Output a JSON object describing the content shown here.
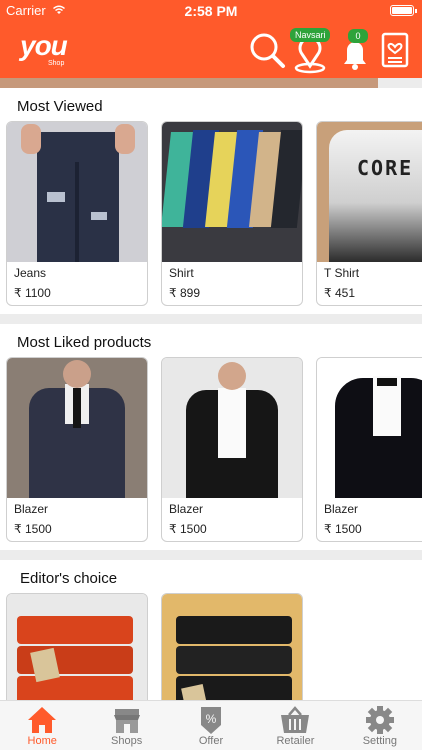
{
  "status_bar": {
    "carrier": "Carrier",
    "time": "2:58 PM"
  },
  "header": {
    "logo_text": "you",
    "logo_sub": "Shop",
    "location_badge": "Navsari",
    "notification_count": "0"
  },
  "sections": [
    {
      "title": "Most Viewed",
      "items": [
        {
          "name": "Jeans",
          "price": "₹ 1100"
        },
        {
          "name": "Shirt",
          "price": "₹ 899"
        },
        {
          "name": "T Shirt",
          "price": "₹ 451"
        }
      ]
    },
    {
      "title": "Most Liked products",
      "items": [
        {
          "name": "Blazer",
          "price": "₹ 1500"
        },
        {
          "name": "Blazer",
          "price": "₹ 1500"
        },
        {
          "name": "Blazer",
          "price": "₹ 1500"
        }
      ]
    },
    {
      "title": "Editor's choice",
      "items": [
        {
          "name": "",
          "price": ""
        },
        {
          "name": "",
          "price": ""
        }
      ]
    }
  ],
  "tabs": [
    {
      "label": "Home",
      "icon": "home-icon",
      "active": true
    },
    {
      "label": "Shops",
      "icon": "shop-icon"
    },
    {
      "label": "Offer",
      "icon": "offer-icon"
    },
    {
      "label": "Retailer",
      "icon": "basket-icon"
    },
    {
      "label": "Setting",
      "icon": "gear-icon"
    }
  ],
  "colors": {
    "brand": "#ff5a2b",
    "badge": "#2ea33a"
  }
}
